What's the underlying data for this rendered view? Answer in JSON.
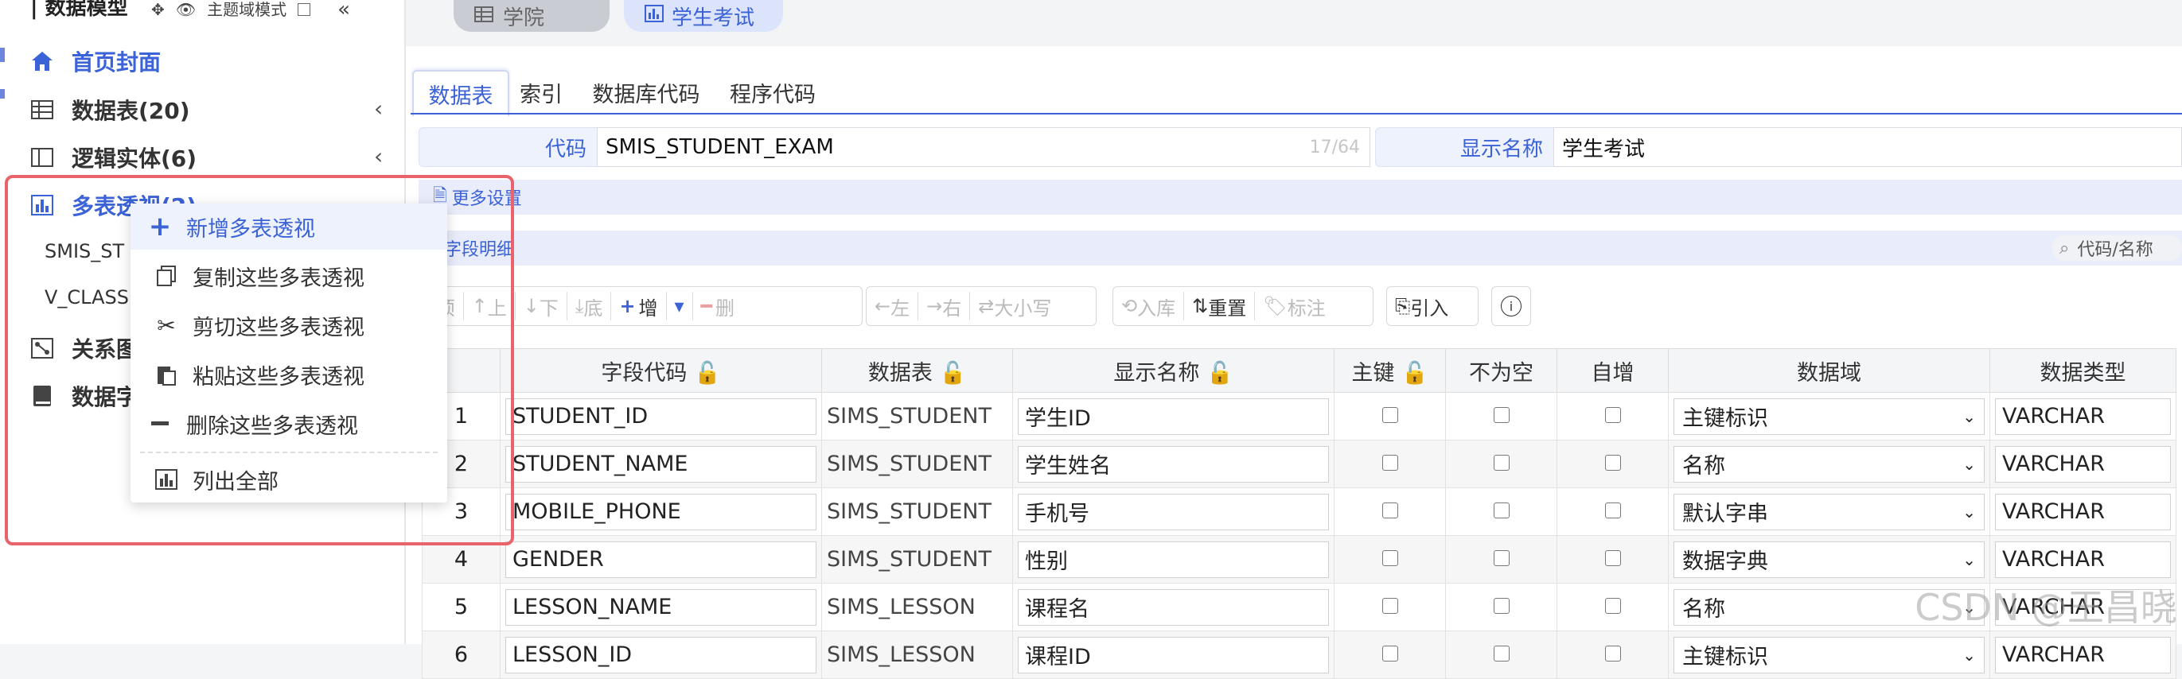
{
  "sidebar": {
    "title": "数据模型",
    "theme_mode_label": "主题域模式",
    "items": [
      {
        "label": "首页封面",
        "icon": "home-icon"
      },
      {
        "label": "数据表(20)",
        "icon": "table-icon"
      },
      {
        "label": "逻辑实体(6)",
        "icon": "entity-icon"
      },
      {
        "label": "多表透视(2)",
        "icon": "pivot-chart-icon"
      },
      {
        "label": "关系图",
        "icon": "diagram-icon"
      },
      {
        "label": "数据字",
        "icon": "book-icon"
      }
    ],
    "sub_items": [
      "SMIS_ST",
      "V_CLASS"
    ]
  },
  "topbar": {
    "tabs": [
      {
        "label": "学院",
        "icon": "table-icon"
      },
      {
        "label": "学生考试",
        "icon": "pivot-chart-icon"
      }
    ]
  },
  "main": {
    "tabs": [
      "数据表",
      "索引",
      "数据库代码",
      "程序代码"
    ],
    "code_label": "代码",
    "code_value": "SMIS_STUDENT_EXAM",
    "code_counter": "17/64",
    "display_name_label": "显示名称",
    "display_name_value": "学生考试",
    "more_settings": "更多设置",
    "field_detail": "字段明细",
    "search_placeholder": "代码/名称"
  },
  "toolbar": {
    "top": "顶",
    "up": "上",
    "down": "下",
    "bottom": "底",
    "add": "增",
    "delete": "删",
    "left": "左",
    "right": "右",
    "case": "大小写",
    "import_db": "入库",
    "reset": "重置",
    "mark": "标注",
    "import": "引入"
  },
  "table": {
    "headers": [
      "字段代码",
      "数据表",
      "显示名称",
      "主键",
      "不为空",
      "自增",
      "数据域",
      "数据类型"
    ],
    "rows": [
      {
        "no": "1",
        "code": "STUDENT_ID",
        "table": "SIMS_STUDENT",
        "name": "学生ID",
        "domain": "主键标识",
        "type": "VARCHAR"
      },
      {
        "no": "2",
        "code": "STUDENT_NAME",
        "table": "SIMS_STUDENT",
        "name": "学生姓名",
        "domain": "名称",
        "type": "VARCHAR"
      },
      {
        "no": "3",
        "code": "MOBILE_PHONE",
        "table": "SIMS_STUDENT",
        "name": "手机号",
        "domain": "默认字串",
        "type": "VARCHAR"
      },
      {
        "no": "4",
        "code": "GENDER",
        "table": "SIMS_STUDENT",
        "name": "性别",
        "domain": "数据字典",
        "type": "VARCHAR"
      },
      {
        "no": "5",
        "code": "LESSON_NAME",
        "table": "SIMS_LESSON",
        "name": "课程名",
        "domain": "名称",
        "type": "VARCHAR"
      },
      {
        "no": "6",
        "code": "LESSON_ID",
        "table": "SIMS_LESSON",
        "name": "课程ID",
        "domain": "主键标识",
        "type": "VARCHAR"
      }
    ]
  },
  "context_menu": {
    "items": [
      {
        "label": "新增多表透视",
        "icon": "plus-icon"
      },
      {
        "label": "复制这些多表透视",
        "icon": "copy-icon"
      },
      {
        "label": "剪切这些多表透视",
        "icon": "scissors-icon"
      },
      {
        "label": "粘贴这些多表透视",
        "icon": "paste-icon"
      },
      {
        "label": "删除这些多表透视",
        "icon": "minus-icon"
      },
      {
        "label": "列出全部",
        "icon": "pivot-chart-icon"
      }
    ]
  },
  "watermark": "CSDN @王昌晓",
  "colors": {
    "accent": "#3b62d6",
    "highlight_box": "#e8636a"
  }
}
